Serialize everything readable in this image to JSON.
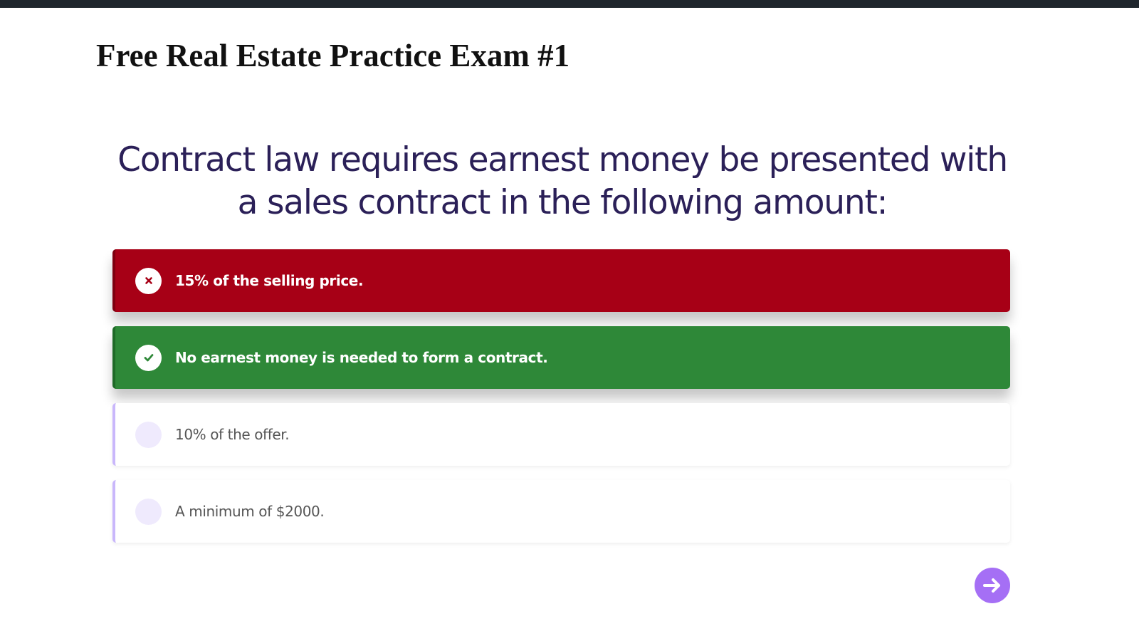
{
  "exam": {
    "title": "Free Real Estate Practice Exam #1"
  },
  "question": {
    "text": "Contract law requires earnest money be presented with a sales contract in the following amount:"
  },
  "answers": [
    {
      "text": "15% of the selling price.",
      "state": "incorrect-selected",
      "icon": "close-icon"
    },
    {
      "text": "No earnest money is needed to form a contract.",
      "state": "correct",
      "icon": "check-icon"
    },
    {
      "text": "10% of the offer.",
      "state": "unselected",
      "icon": "radio-empty-icon"
    },
    {
      "text": "A minimum of $2000.",
      "state": "unselected",
      "icon": "radio-empty-icon"
    }
  ],
  "navigation": {
    "next_icon": "arrow-right-icon"
  },
  "colors": {
    "incorrect": "#a70016",
    "correct": "#2e8838",
    "accent": "#a56ff5",
    "question_text": "#2b2058"
  }
}
